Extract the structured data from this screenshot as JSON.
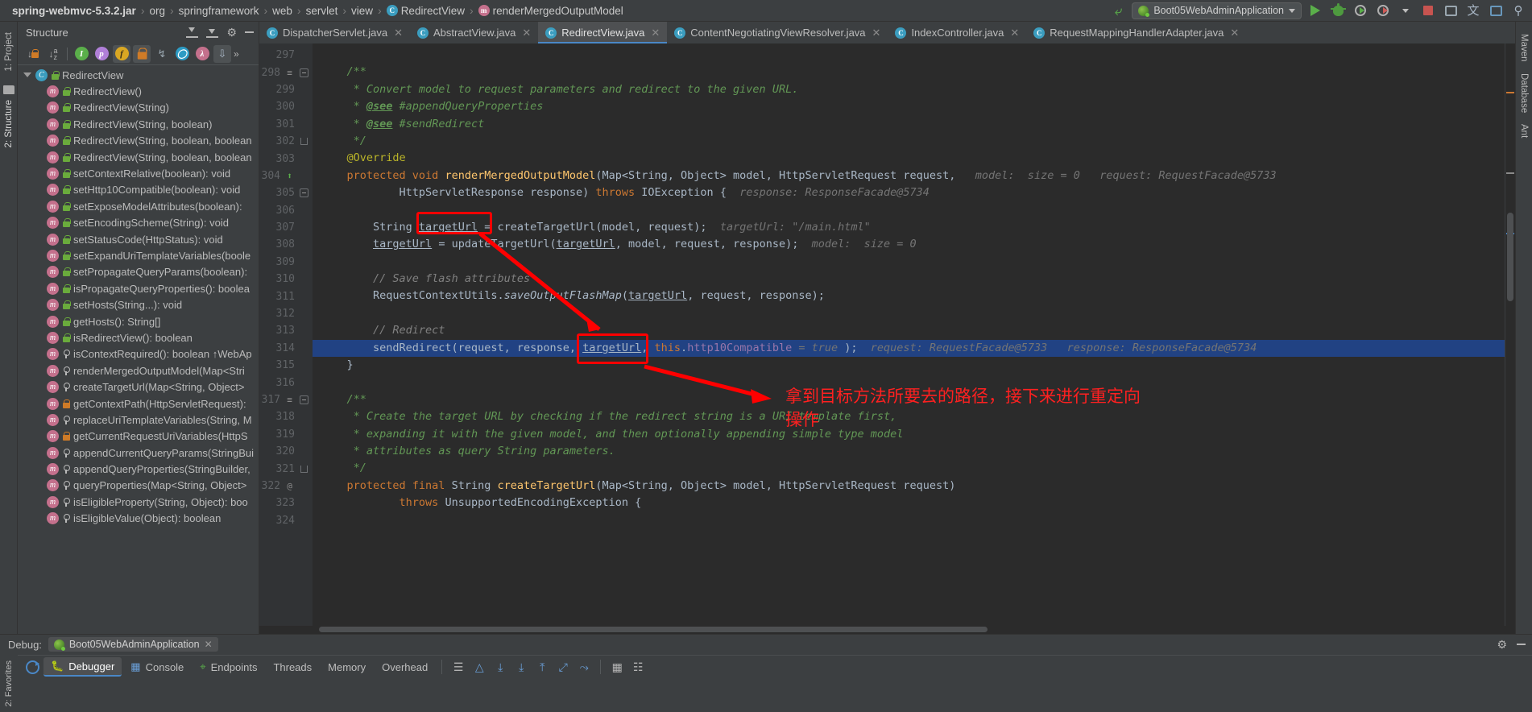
{
  "navbar": {
    "breadcrumbs": [
      {
        "label": "spring-webmvc-5.3.2.jar",
        "icon": "",
        "bold": true
      },
      {
        "label": "org",
        "icon": ""
      },
      {
        "label": "springframework",
        "icon": ""
      },
      {
        "label": "web",
        "icon": ""
      },
      {
        "label": "servlet",
        "icon": ""
      },
      {
        "label": "view",
        "icon": ""
      },
      {
        "label": "RedirectView",
        "icon": "class-icon"
      },
      {
        "label": "renderMergedOutputModel",
        "icon": "method-icon"
      }
    ],
    "separator": "›",
    "run_config": "Boot05WebAdminApplication",
    "actions": [
      "run-button",
      "debug-button",
      "run-coverage-button",
      "profiler-button",
      "stop-button",
      "build-button",
      "translate-button",
      "terminal-button",
      "search-button"
    ]
  },
  "left_strip": {
    "tabs": [
      "1: Project",
      "2: Structure"
    ]
  },
  "structure": {
    "title": "Structure",
    "toolbar_icons": [
      "sort-by-visibility",
      "sort-alphabetically",
      "show-inherited",
      "show-properties",
      "show-fields",
      "show-non-public",
      "show-anonymous",
      "show-lambdas",
      "show-functional",
      "autoscroll-to-source",
      "more-options"
    ],
    "tree": [
      {
        "level": 0,
        "icon": "class-icon",
        "vis": "green-lock",
        "label": "RedirectView",
        "expanded": true
      },
      {
        "level": 1,
        "icon": "method-icon",
        "vis": "green-lock",
        "label": "RedirectView()"
      },
      {
        "level": 1,
        "icon": "method-icon",
        "vis": "green-lock",
        "label": "RedirectView(String)"
      },
      {
        "level": 1,
        "icon": "method-icon",
        "vis": "green-lock",
        "label": "RedirectView(String, boolean)"
      },
      {
        "level": 1,
        "icon": "method-icon",
        "vis": "green-lock",
        "label": "RedirectView(String, boolean, boolean"
      },
      {
        "level": 1,
        "icon": "method-icon",
        "vis": "green-lock",
        "label": "RedirectView(String, boolean, boolean"
      },
      {
        "level": 1,
        "icon": "method-icon",
        "vis": "green-lock",
        "label": "setContextRelative(boolean): void"
      },
      {
        "level": 1,
        "icon": "method-icon",
        "vis": "green-lock",
        "label": "setHttp10Compatible(boolean): void"
      },
      {
        "level": 1,
        "icon": "method-icon",
        "vis": "green-lock",
        "label": "setExposeModelAttributes(boolean):"
      },
      {
        "level": 1,
        "icon": "method-icon",
        "vis": "green-lock",
        "label": "setEncodingScheme(String): void"
      },
      {
        "level": 1,
        "icon": "method-icon",
        "vis": "green-lock",
        "label": "setStatusCode(HttpStatus): void"
      },
      {
        "level": 1,
        "icon": "method-icon",
        "vis": "green-lock",
        "label": "setExpandUriTemplateVariables(boole"
      },
      {
        "level": 1,
        "icon": "method-icon",
        "vis": "green-lock",
        "label": "setPropagateQueryParams(boolean):"
      },
      {
        "level": 1,
        "icon": "method-icon",
        "vis": "green-lock",
        "label": "isPropagateQueryProperties(): boolea"
      },
      {
        "level": 1,
        "icon": "method-icon",
        "vis": "green-lock",
        "label": "setHosts(String...): void"
      },
      {
        "level": 1,
        "icon": "method-icon",
        "vis": "green-lock",
        "label": "getHosts(): String[]"
      },
      {
        "level": 1,
        "icon": "method-icon",
        "vis": "green-lock",
        "label": "isRedirectView(): boolean"
      },
      {
        "level": 1,
        "icon": "method-icon",
        "vis": "key",
        "label": "isContextRequired(): boolean ↑WebAp"
      },
      {
        "level": 1,
        "icon": "method-icon",
        "vis": "key",
        "label": "renderMergedOutputModel(Map<Stri"
      },
      {
        "level": 1,
        "icon": "method-icon",
        "vis": "key",
        "label": "createTargetUrl(Map<String, Object>"
      },
      {
        "level": 1,
        "icon": "method-icon",
        "vis": "orange-lock",
        "label": "getContextPath(HttpServletRequest):"
      },
      {
        "level": 1,
        "icon": "method-icon",
        "vis": "key",
        "label": "replaceUriTemplateVariables(String, M"
      },
      {
        "level": 1,
        "icon": "method-icon",
        "vis": "orange-lock",
        "label": "getCurrentRequestUriVariables(HttpS"
      },
      {
        "level": 1,
        "icon": "method-icon",
        "vis": "key",
        "label": "appendCurrentQueryParams(StringBui"
      },
      {
        "level": 1,
        "icon": "method-icon",
        "vis": "key",
        "label": "appendQueryProperties(StringBuilder,"
      },
      {
        "level": 1,
        "icon": "method-icon",
        "vis": "key",
        "label": "queryProperties(Map<String, Object>"
      },
      {
        "level": 1,
        "icon": "method-icon",
        "vis": "key",
        "label": "isEligibleProperty(String, Object): boo"
      },
      {
        "level": 1,
        "icon": "method-icon",
        "vis": "key",
        "label": "isEligibleValue(Object): boolean"
      }
    ]
  },
  "editor": {
    "tabs": [
      {
        "label": "DispatcherServlet.java",
        "active": false
      },
      {
        "label": "AbstractView.java",
        "active": false
      },
      {
        "label": "RedirectView.java",
        "active": true
      },
      {
        "label": "ContentNegotiatingViewResolver.java",
        "active": false
      },
      {
        "label": "IndexController.java",
        "active": false
      },
      {
        "label": "RequestMappingHandlerAdapter.java",
        "active": false
      }
    ],
    "first_line": 297,
    "selected_line": 314,
    "lines": [
      {
        "n": 297,
        "html": ""
      },
      {
        "n": 298,
        "html": "    <span class='cmt'>/**</span>",
        "marker": "fold-start",
        "lm": true
      },
      {
        "n": 299,
        "html": "     <span class='cmt'>* Convert model to request parameters and redirect to the given URL.</span>"
      },
      {
        "n": 300,
        "html": "     <span class='cmt'>* </span><span class='see'>@see</span><span class='cmt'> #appendQueryProperties</span>"
      },
      {
        "n": 301,
        "html": "     <span class='cmt'>* </span><span class='see'>@see</span><span class='cmt'> #sendRedirect</span>"
      },
      {
        "n": 302,
        "html": "     <span class='cmt'>*/</span>",
        "marker": "fold-end"
      },
      {
        "n": 303,
        "html": "    <span class='ann'>@Override</span>"
      },
      {
        "n": 304,
        "html": "    <span class='kw'>protected void </span><span class='mth'>renderMergedOutputModel</span>(Map&lt;String, Object&gt; model, HttpServletRequest request,<span class='hint'>   model:  size = 0   request: RequestFacade@5733</span>",
        "marker": "override"
      },
      {
        "n": 305,
        "html": "            HttpServletResponse response) <span class='kw'>throws </span>IOException {<span class='hint'>  response: ResponseFacade@5734</span>",
        "marker": "fold-start2"
      },
      {
        "n": 306,
        "html": ""
      },
      {
        "n": 307,
        "html": "        String <span class='u'>targetUrl</span> = createTargetUrl(model, request);<span class='hint'>  targetUrl: \"/main.html\"</span>"
      },
      {
        "n": 308,
        "html": "        <span class='u'>targetUrl</span> = updateTargetUrl(<span class='u'>targetUrl</span>, model, request, response);<span class='hint'>  model:  size = 0</span>"
      },
      {
        "n": 309,
        "html": ""
      },
      {
        "n": 310,
        "html": "        <span class='cmt2'>// Save flash attributes</span>"
      },
      {
        "n": 311,
        "html": "        RequestContextUtils.<span class='it'>saveOutputFlashMap</span>(<span class='u'>targetUrl</span>, request, response);"
      },
      {
        "n": 312,
        "html": ""
      },
      {
        "n": 313,
        "html": "        <span class='cmt2'>// Redirect</span>"
      },
      {
        "n": 314,
        "html": "        sendRedirect(request, response, <span class='u'>targetUrl</span>, <span class='kw'>this</span>.<span class='fld'>http10Compatible</span><span class='hint'> = true </span>);<span class='hint'>  request: RequestFacade@5733   response: ResponseFacade@5734</span>",
        "selected": true
      },
      {
        "n": 315,
        "html": "    }"
      },
      {
        "n": 316,
        "html": ""
      },
      {
        "n": 317,
        "html": "    <span class='cmt'>/**</span>",
        "marker": "fold-start",
        "lm": true
      },
      {
        "n": 318,
        "html": "     <span class='cmt'>* Create the target URL by checking if the redirect string is a URI template first,</span>"
      },
      {
        "n": 319,
        "html": "     <span class='cmt'>* expanding it with the given model, and then optionally appending simple type model</span>"
      },
      {
        "n": 320,
        "html": "     <span class='cmt'>* attributes as query String parameters.</span>"
      },
      {
        "n": 321,
        "html": "     <span class='cmt'>*/</span>",
        "marker": "fold-end"
      },
      {
        "n": 322,
        "html": "    <span class='kw'>protected final </span>String <span class='mth'>createTargetUrl</span>(Map&lt;String, Object&gt; model, HttpServletRequest request)",
        "marker": "at"
      },
      {
        "n": 323,
        "html": "            <span class='kw'>throws </span>UnsupportedEncodingException {"
      },
      {
        "n": 324,
        "html": ""
      }
    ]
  },
  "right_strip": {
    "tabs": [
      "Maven",
      "Database",
      "Ant"
    ]
  },
  "annotation": {
    "text_line1": "拿到目标方法所要去的路径，接下来进行重定向",
    "text_line2": "操作",
    "color": "#ff2020"
  },
  "debug_panel": {
    "label": "Debug:",
    "session_tab": "Boot05WebAdminApplication",
    "tabs": [
      {
        "label": "Debugger",
        "icon": "bug-icon",
        "active": true
      },
      {
        "label": "Console",
        "icon": "console-icon",
        "active": false
      },
      {
        "label": "Endpoints",
        "icon": "endpoints-icon",
        "active": false
      },
      {
        "label": "Threads",
        "icon": "",
        "active": false
      },
      {
        "label": "Memory",
        "icon": "",
        "active": false
      },
      {
        "label": "Overhead",
        "icon": "",
        "active": false
      }
    ],
    "action_icons": [
      "frames-icon",
      "export-icon",
      "download-icon",
      "download-alt-icon",
      "upload-icon",
      "step-icon",
      "mute-icon",
      "layout-icon",
      "settings-list-icon"
    ],
    "window_actions": [
      "settings-gear",
      "minimize"
    ]
  },
  "bottom_strip": {
    "tabs": [
      "2: Favorites"
    ]
  }
}
